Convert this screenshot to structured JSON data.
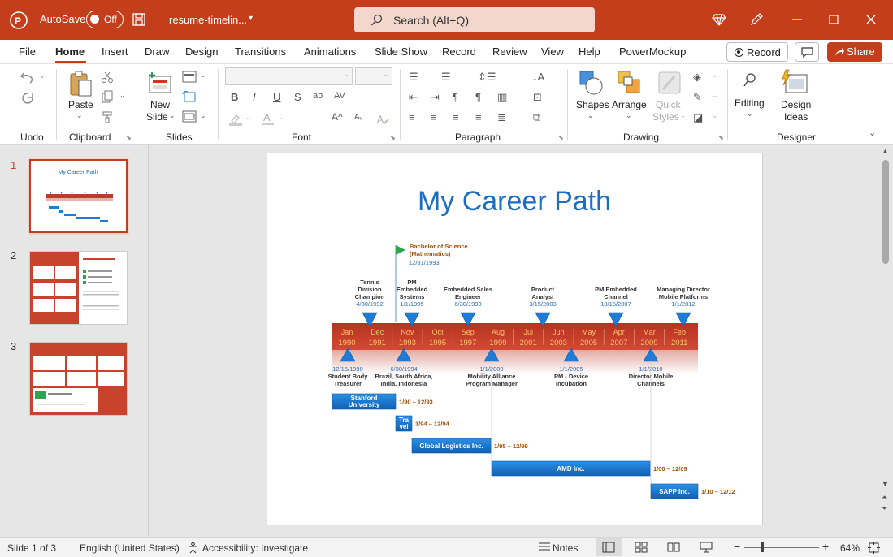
{
  "titlebar": {
    "autosave_label": "AutoSave",
    "autosave_state": "Off",
    "doc_title": "resume-timelin...",
    "search_placeholder": "Search (Alt+Q)"
  },
  "tabs": [
    "File",
    "Home",
    "Insert",
    "Draw",
    "Design",
    "Transitions",
    "Animations",
    "Slide Show",
    "Record",
    "Review",
    "View",
    "Help",
    "PowerMockup"
  ],
  "active_tab": "Home",
  "actions": {
    "record": "Record",
    "share": "Share"
  },
  "ribbon": {
    "groups": [
      "Undo",
      "Clipboard",
      "Slides",
      "Font",
      "Paragraph",
      "Drawing",
      "Designer"
    ],
    "paste": "Paste",
    "new_slide_1": "New",
    "new_slide_2": "Slide",
    "shapes": "Shapes",
    "arrange": "Arrange",
    "quick_styles_1": "Quick",
    "quick_styles_2": "Styles",
    "editing": "Editing",
    "design_ideas_1": "Design",
    "design_ideas_2": "Ideas",
    "font_buttons": [
      "B",
      "I",
      "U",
      "S",
      "ab",
      "AV"
    ]
  },
  "thumbnails": {
    "numbers": [
      "1",
      "2",
      "3"
    ],
    "thumb1_title": "My Career Path"
  },
  "slide": {
    "title": "My Career Path",
    "title_color": "#1b6ec2",
    "milestone_top": {
      "label1": "Bachelor of Science",
      "label2": "(Mathematics)",
      "date": "12/31/1993"
    },
    "axis_months": [
      {
        "m": "Jan",
        "y": "1990"
      },
      {
        "m": "Dec",
        "y": "1991"
      },
      {
        "m": "Nov",
        "y": "1993"
      },
      {
        "m": "Oct",
        "y": "1995"
      },
      {
        "m": "Sep",
        "y": "1997"
      },
      {
        "m": "Aug",
        "y": "1999"
      },
      {
        "m": "Jul",
        "y": "2001"
      },
      {
        "m": "Jun",
        "y": "2003"
      },
      {
        "m": "May",
        "y": "2005"
      },
      {
        "m": "Apr",
        "y": "2007"
      },
      {
        "m": "Mar",
        "y": "2009"
      },
      {
        "m": "Feb",
        "y": "2011"
      }
    ],
    "events_above": [
      {
        "l1": "Tennis",
        "l2": "Division",
        "l3": "Champion",
        "date": "4/30/1992"
      },
      {
        "l1": "PM",
        "l2": "Embedded",
        "l3": "Systems",
        "date": "1/1/1995"
      },
      {
        "l1": "Embedded Sales",
        "l2": "Engineer",
        "l3": "",
        "date": "6/30/1998"
      },
      {
        "l1": "Product",
        "l2": "Analyst",
        "l3": "",
        "date": "3/15/2003"
      },
      {
        "l1": "PM Embedded",
        "l2": "Channel",
        "l3": "",
        "date": "10/15/2007"
      },
      {
        "l1": "Managing Director",
        "l2": "Mobile Platforms",
        "l3": "",
        "date": "1/1/2012"
      }
    ],
    "events_below": [
      {
        "date": "12/15/1990",
        "l1": "Student Body",
        "l2": "Treasurer",
        "l3": ""
      },
      {
        "date": "6/30/1994",
        "l1": "Brazil, South Africa,",
        "l2": "India, Indonesia",
        "l3": ""
      },
      {
        "date": "1/1/2000",
        "l1": "Mobility Alliance",
        "l2": "Program Manager",
        "l3": ""
      },
      {
        "date": "1/1/2005",
        "l1": "PM - Device",
        "l2": "Incubation",
        "l3": ""
      },
      {
        "date": "1/1/2010",
        "l1": "Director  Mobile",
        "l2": "Channels",
        "l3": ""
      }
    ],
    "bars": [
      {
        "name1": "Stanford",
        "name2": "University",
        "range": "1/90  –  12/93"
      },
      {
        "name1": "Tra",
        "name2": "vel",
        "range": "1/94  –  12/94"
      },
      {
        "name1": "Global Logistics Inc.",
        "name2": "",
        "range": "1/95  –  12/99"
      },
      {
        "name1": "AMD Inc.",
        "name2": "",
        "range": "1/00  –  12/09"
      },
      {
        "name1": "SAPP Inc.",
        "name2": "",
        "range": "1/10  –  12/12"
      }
    ]
  },
  "status": {
    "slide_of": "Slide 1 of 3",
    "language": "English (United States)",
    "accessibility": "Accessibility: Investigate",
    "notes": "Notes",
    "zoom": "64%"
  }
}
